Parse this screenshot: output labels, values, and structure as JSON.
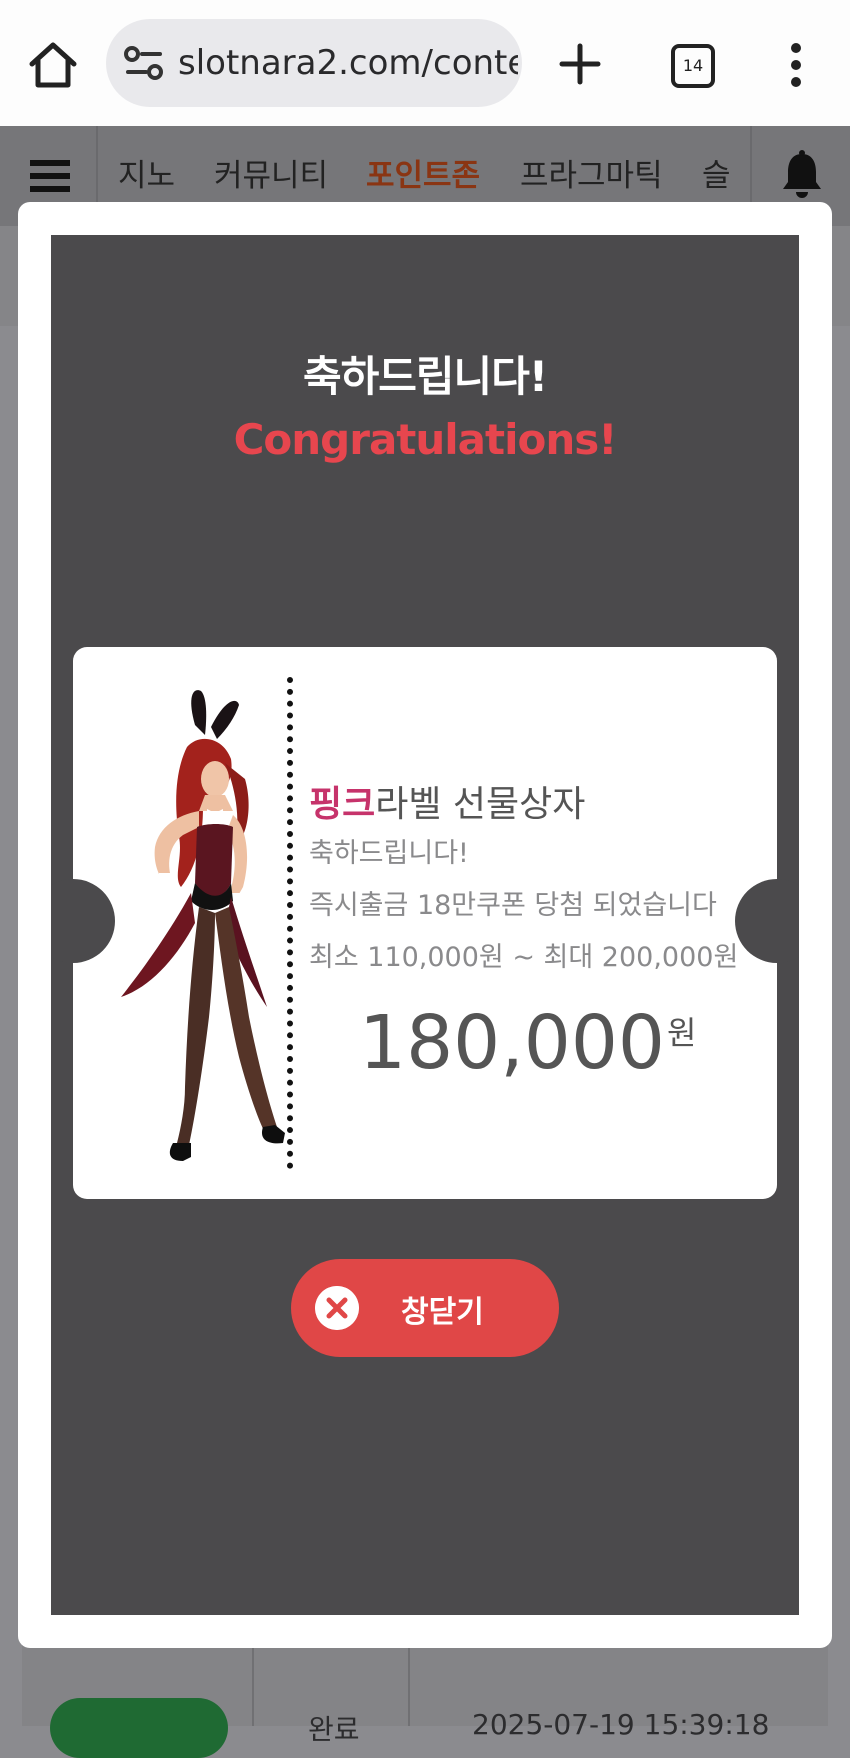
{
  "browser": {
    "url": "slotnara2.com/conte",
    "tab_count": "14",
    "icons": [
      "home-icon",
      "site-settings-icon",
      "plus-icon",
      "tab-switcher-icon",
      "more-vert-icon"
    ]
  },
  "nav": {
    "items": [
      {
        "label": "지노"
      },
      {
        "label": "커뮤니티"
      },
      {
        "label": "포인트존"
      },
      {
        "label": "프라그마틱"
      },
      {
        "label": "슬"
      }
    ],
    "active_index": 2,
    "icons": [
      "hamburger-menu-icon",
      "bell-icon"
    ]
  },
  "background_table": {
    "status": "완료",
    "datetime": "2025-07-19 15:39:18"
  },
  "modal": {
    "heading_ko": "축하드립니다!",
    "heading_en": "Congratulations!",
    "ticket": {
      "title_highlight": "핑크",
      "title_rest": "라벨 선물상자",
      "line1": "축하드립니다!",
      "line2": "즉시출금 18만쿠폰 당첨 되었습니다",
      "line3": "최소 110,000원 ~ 최대 200,000원",
      "amount": "180,000",
      "unit": "원"
    },
    "close_label": "창닫기"
  },
  "colors": {
    "accent_red": "#e04747",
    "heading_red": "#e7464e",
    "pink": "#c6336b",
    "active_nav": "#8a3513",
    "modal_inner": "#4b4a4c"
  }
}
